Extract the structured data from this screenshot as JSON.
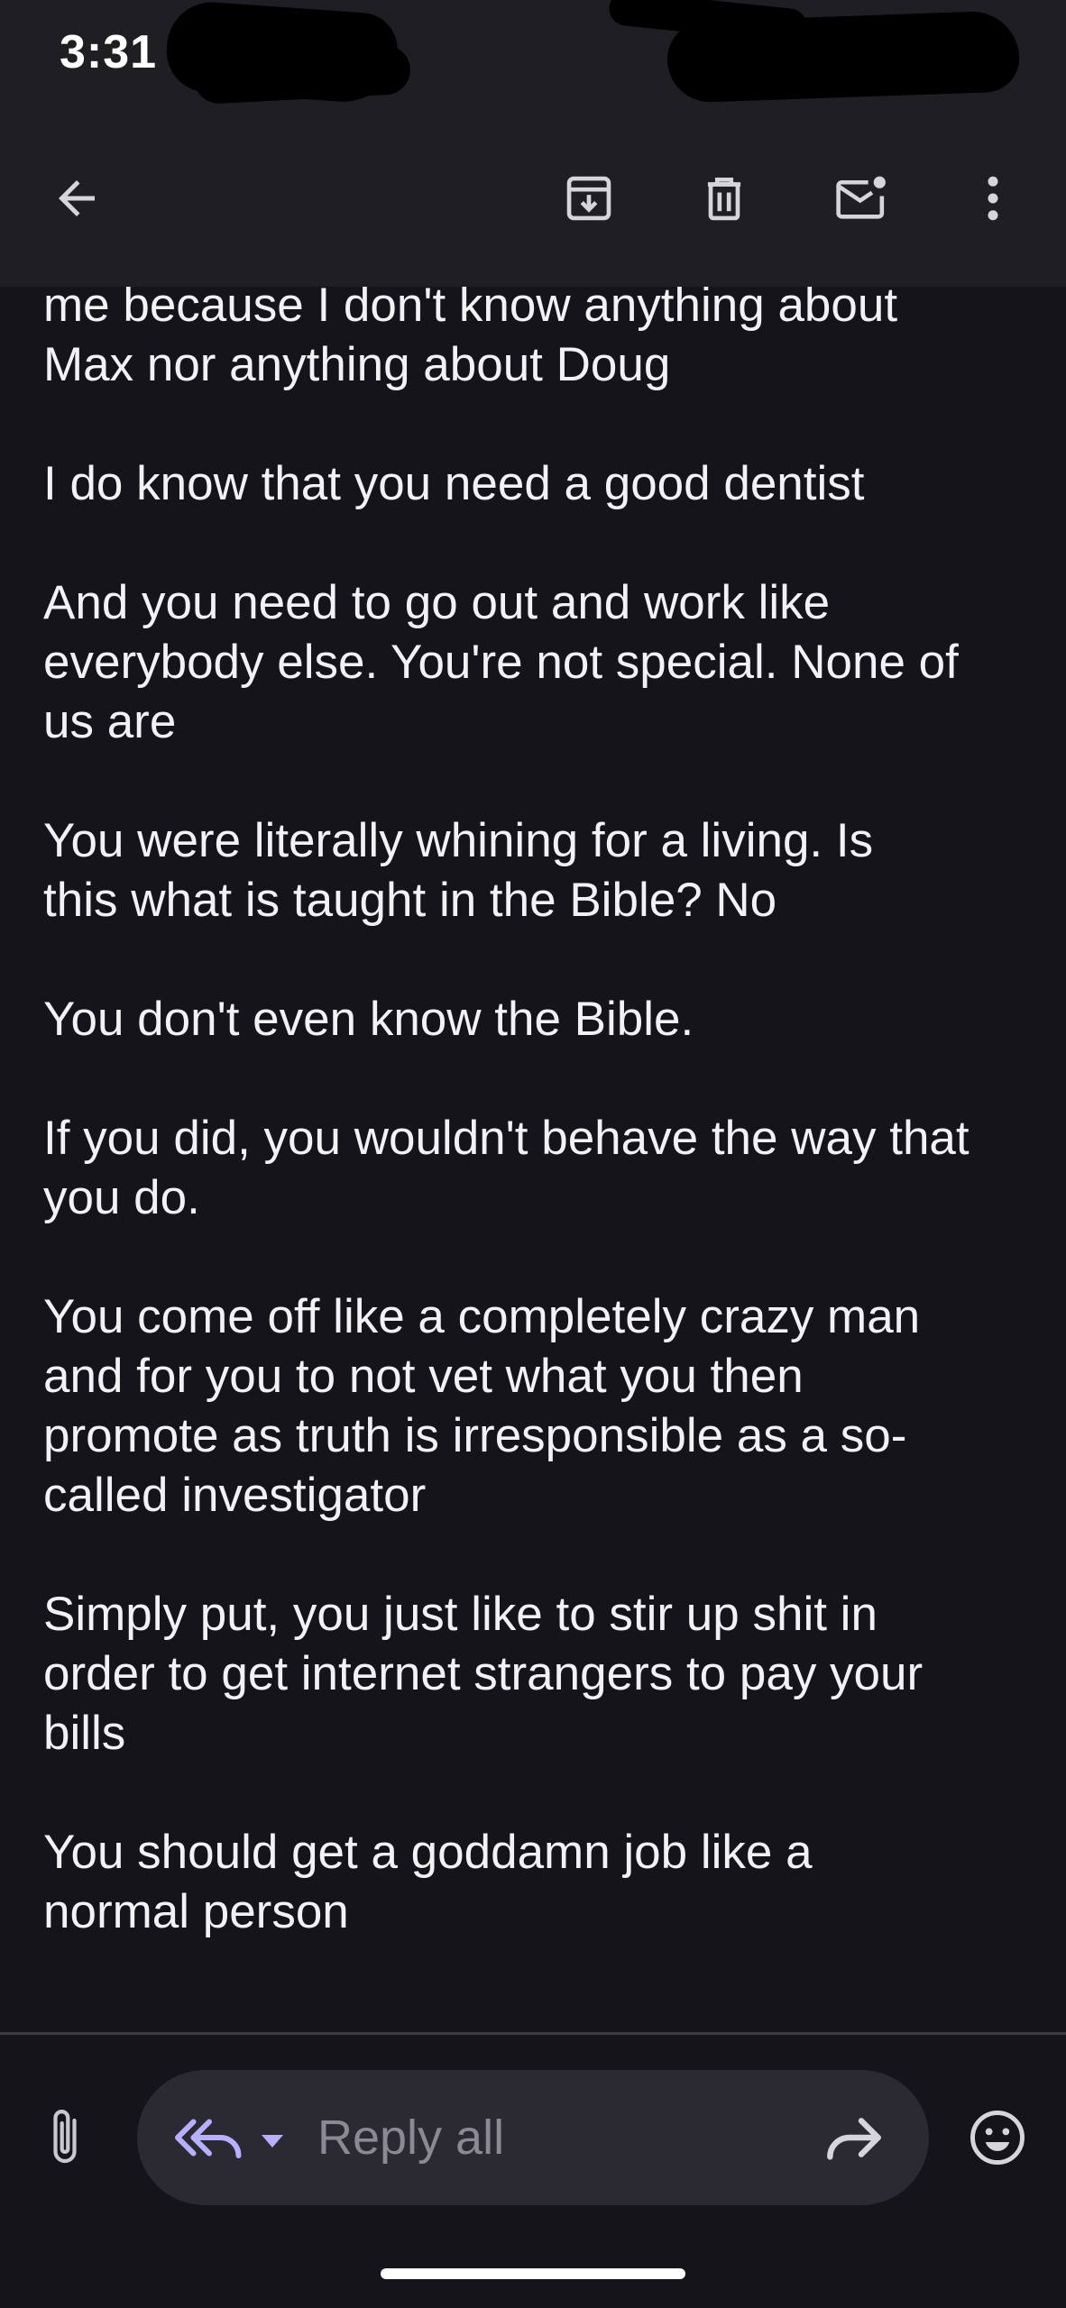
{
  "status_bar": {
    "time": "3:31"
  },
  "toolbar": {
    "icons": {
      "back": "arrow-left-icon",
      "archive": "archive-icon",
      "delete": "trash-icon",
      "mark_unread": "mail-unread-icon",
      "more": "more-vert-icon"
    }
  },
  "email": {
    "paragraphs": [
      "me because I don't know anything about\nMax nor anything about Doug",
      "I do know that you need a good dentist",
      "And you need to go out and work like\neverybody else. You're not special. None of\nus are",
      "You were literally whining for a living. Is\nthis what is taught in the Bible? No",
      "You don't even know the Bible.",
      "If you did, you wouldn't behave the way that\nyou do.",
      "You come off like a completely crazy man\nand for you to not vet what you then\npromote as truth is irresponsible as a so-\ncalled investigator",
      "Simply put, you just like to stir up shit in\norder to get internet strangers to pay your\nbills",
      "You should get a goddamn job like a\nnormal person"
    ]
  },
  "reply_bar": {
    "label": "Reply all",
    "icons": {
      "attach": "paperclip-icon",
      "reply_all": "reply-all-icon",
      "dropdown": "caret-down-icon",
      "forward": "forward-icon",
      "emoji": "emoji-icon"
    }
  },
  "colors": {
    "background": "#15141a",
    "toolbar_background": "#1f1f23",
    "text": "#f2f2f4",
    "reply_pill": "#2b2a33",
    "accent": "#b7b0ff"
  }
}
